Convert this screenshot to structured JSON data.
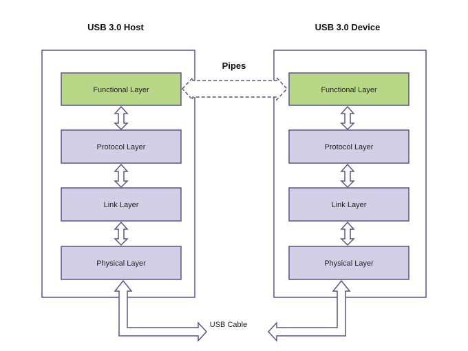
{
  "host": {
    "title": "USB 3.0 Host",
    "layers": [
      "Functional Layer",
      "Protocol Layer",
      "Link Layer",
      "Physical Layer"
    ]
  },
  "device": {
    "title": "USB 3.0 Device",
    "layers": [
      "Functional Layer",
      "Protocol Layer",
      "Link Layer",
      "Physical Layer"
    ]
  },
  "pipes_label": "Pipes",
  "cable_label": "USB Cable",
  "colors": {
    "outline": "#5b5485",
    "functional_fill": "#b8d887",
    "layer_fill": "#d3cfe6"
  }
}
